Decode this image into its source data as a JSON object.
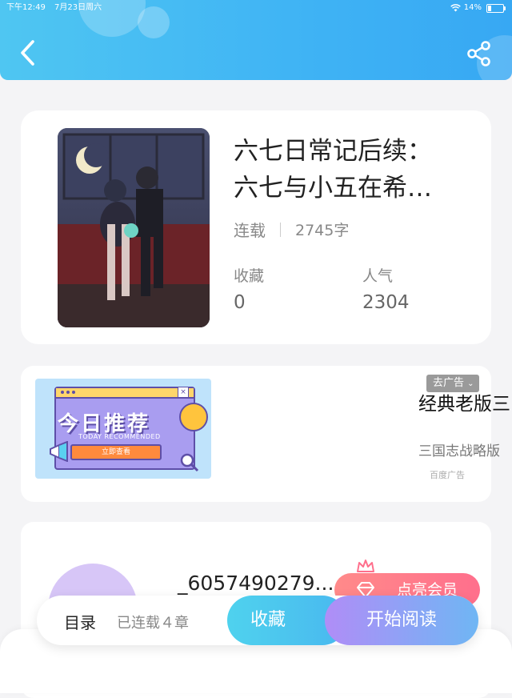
{
  "status_bar": {
    "time": "下午12:49",
    "date": "7月23日周六",
    "battery": "14%",
    "wifi_icon": "wifi-icon",
    "battery_icon": "battery-icon"
  },
  "header": {
    "back_icon": "chevron-left-icon",
    "share_icon": "share-icon",
    "colors": {
      "gradient_start": "#4fc6f2",
      "gradient_end": "#37a8f3"
    }
  },
  "book": {
    "title_line1": "六七日常记后续：",
    "title_line2": "六七与小五在希…",
    "status": "连载",
    "word_count": "2745字",
    "stats": [
      {
        "label": "收藏",
        "value": "0"
      },
      {
        "label": "人气",
        "value": "2304"
      }
    ]
  },
  "ad": {
    "image_headline": "今日推荐",
    "image_subline": "TODAY RECOMMENDED",
    "image_button": "立即查看",
    "close_tag": "去广告",
    "title": "经典老版三",
    "description": "三国志战略版",
    "source": "百度广告"
  },
  "author": {
    "name": "_6057490279...",
    "vip_button": "点亮会员"
  },
  "bottom_bar": {
    "toc_label": "目录",
    "toc_status": "已连载４章",
    "collect_button": "收藏",
    "read_button": "开始阅读"
  }
}
